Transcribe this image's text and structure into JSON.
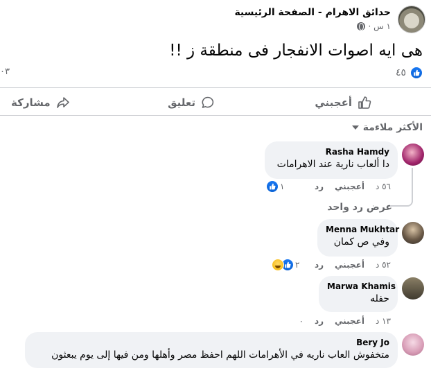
{
  "post": {
    "page_name": "حدائق الاهرام - الصفحة الرئيسية",
    "time": "١ س ·",
    "text": "هى ايه اصوات الانفجار فى منطقة ز !!",
    "reaction_count": "٤٥",
    "left_count": "٠٣"
  },
  "actions": {
    "like": "أعجبني",
    "comment": "تعليق",
    "share": "مشاركة"
  },
  "filter": {
    "label": "الأكثر ملاءمة"
  },
  "comments": [
    {
      "name": "Rasha Hamdy",
      "text": "دا ألعاب نارية عند الاهرامات",
      "time": "٥٦ د",
      "like": "أعجبني",
      "reply": "رد",
      "reaction_count": "١"
    },
    {
      "name": "Menna Mukhtar",
      "text": "وفي ص كمان",
      "time": "٥٢ د",
      "like": "أعجبني",
      "reply": "رد",
      "reaction_count": "٢"
    },
    {
      "name": "Marwa Khamis",
      "text": "حفله",
      "time": "١٣ د",
      "like": "أعجبني",
      "reply": "رد",
      "reaction_count": "٠"
    },
    {
      "name": "Bery Jo",
      "text": "متخفوش العاب ناريه في الأهرامات اللهم احفظ مصر وأهلها ومن فيها إلى يوم يبعثون"
    }
  ],
  "view_replies": "عرض رد واحد",
  "colors": {
    "accent": "#1877f2",
    "bubble": "#f0f2f5",
    "muted": "#65676b"
  }
}
